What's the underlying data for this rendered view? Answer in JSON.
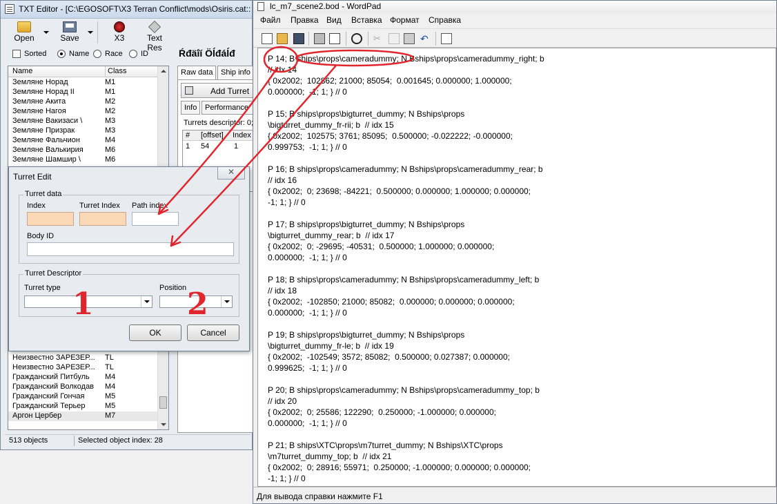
{
  "txt_editor": {
    "title": "TXT Editor - [C:\\EGOSOFT\\X3 Terran Conflict\\mods\\Osiris.cat::",
    "toolbar": {
      "open": "Open",
      "save": "Save",
      "x3": "X3",
      "text_res": "Text Res"
    },
    "filter": {
      "sorted": "Sorted",
      "name": "Name",
      "race": "Race",
      "id": "ID",
      "selected": "Name"
    },
    "header_garbled": "Ŕđäîí Öĺđáĺđ",
    "list_headers": {
      "name": "Name",
      "class": "Class"
    },
    "rows_top": [
      {
        "name": "Земляне Норад",
        "cls": "M1"
      },
      {
        "name": "Земляне Норад II",
        "cls": "M1"
      },
      {
        "name": "Земляне Акита",
        "cls": "M2"
      },
      {
        "name": "Земляне Нагоя",
        "cls": "M2"
      },
      {
        "name": "Земляне Вакизаси \\",
        "cls": "M3"
      },
      {
        "name": "Земляне Призрак",
        "cls": "M3"
      },
      {
        "name": "Земляне Фальчион",
        "cls": "M4"
      },
      {
        "name": "Земляне Валькирия",
        "cls": "M6"
      },
      {
        "name": "Земляне Шамшир \\",
        "cls": "M6"
      }
    ],
    "rows_bottom": [
      {
        "name": "Неизвестно ЗАРЕЗЕР...",
        "cls": "TL"
      },
      {
        "name": "Неизвестно ЗАРЕЗЕР...",
        "cls": "TL"
      },
      {
        "name": "Неизвестно ЗАРЕЗЕР...",
        "cls": "TL"
      },
      {
        "name": "Гражданский Питбуль",
        "cls": "M4"
      },
      {
        "name": "Гражданский Волкодав",
        "cls": "M4"
      },
      {
        "name": "Гражданский Гончая",
        "cls": "M5"
      },
      {
        "name": "Гражданский Терьер",
        "cls": "M5"
      },
      {
        "name": "Аргон Цербер",
        "cls": "M7"
      }
    ],
    "tabs": {
      "raw_data": "Raw data",
      "ship_info": "Ship info"
    },
    "add_turret": "Add Turret",
    "subtabs": {
      "info": "Info",
      "performance": "Performance"
    },
    "turrets_descriptor": "Turrets descriptor: 0;",
    "turret_table": {
      "headers": [
        "#",
        "[offset]",
        "Index"
      ],
      "row": [
        "1",
        "54",
        "1"
      ]
    },
    "status": {
      "count": "513 objects",
      "selected": "Selected object index: 28"
    }
  },
  "turret_dialog": {
    "title": "Turret Edit",
    "close": "✕",
    "turret_data": "Turret data",
    "index": "Index",
    "turret_index": "Turret Index",
    "path_index": "Path index",
    "body_id": "Body ID",
    "turret_descriptor": "Turret Descriptor",
    "turret_type": "Turret type",
    "position": "Position",
    "ok": "OK",
    "cancel": "Cancel",
    "annotation_1": "1",
    "annotation_2": "2"
  },
  "wordpad": {
    "title": "lc_m7_scene2.bod - WordPad",
    "menu": [
      "Файл",
      "Правка",
      "Вид",
      "Вставка",
      "Формат",
      "Справка"
    ],
    "lines": [
      "P 14; B ships\\props\\cameradummy; N Bships\\props\\cameradummy_right; b",
      "// idx 14",
      "{ 0x2002;  102862; 21000; 85054;  0.001645; 0.000000; 1.000000;",
      "0.000000;  -1; 1; } // 0",
      "",
      "P 15; B ships\\props\\bigturret_dummy; N Bships\\props",
      "\\bigturret_dummy_fr-rii; b  // idx 15",
      "{ 0x2002;  102575; 3761; 85095;  0.500000; -0.022222; -0.000000;",
      "0.999753;  -1; 1; } // 0",
      "",
      "P 16; B ships\\props\\cameradummy; N Bships\\props\\cameradummy_rear; b",
      "// idx 16",
      "{ 0x2002;  0; 23698; -84221;  0.500000; 0.000000; 1.000000; 0.000000;",
      "-1; 1; } // 0",
      "",
      "P 17; B ships\\props\\bigturret_dummy; N Bships\\props",
      "\\bigturret_dummy_rear; b  // idx 17",
      "{ 0x2002;  0; -29695; -40531;  0.500000; 1.000000; 0.000000;",
      "0.000000;  -1; 1; } // 0",
      "",
      "P 18; B ships\\props\\cameradummy; N Bships\\props\\cameradummy_left; b",
      "// idx 18",
      "{ 0x2002;  -102850; 21000; 85082;  0.000000; 0.000000; 0.000000;",
      "0.000000;  -1; 1; } // 0",
      "",
      "P 19; B ships\\props\\bigturret_dummy; N Bships\\props",
      "\\bigturret_dummy_fr-le; b  // idx 19",
      "{ 0x2002;  -102549; 3572; 85082;  0.500000; 0.027387; 0.000000;",
      "0.999625;  -1; 1; } // 0",
      "",
      "P 20; B ships\\props\\cameradummy; N Bships\\props\\cameradummy_top; b",
      "// idx 20",
      "{ 0x2002;  0; 25586; 122290;  0.250000; -1.000000; 0.000000;",
      "0.000000;  -1; 1; } // 0",
      "",
      "P 21; B ships\\XTC\\props\\m7turret_dummy; N Bships\\XTC\\props",
      "\\m7turret_dummy_top; b  // idx 21",
      "{ 0x2002;  0; 28916; 55971;  0.250000; -1.000000; 0.000000; 0.000000;",
      "-1; 1; } // 0"
    ],
    "status": "Для вывода справки нажмите F1"
  },
  "colors": {
    "annotation_red": "#e0262c",
    "peach_field": "#fcd9b6"
  }
}
